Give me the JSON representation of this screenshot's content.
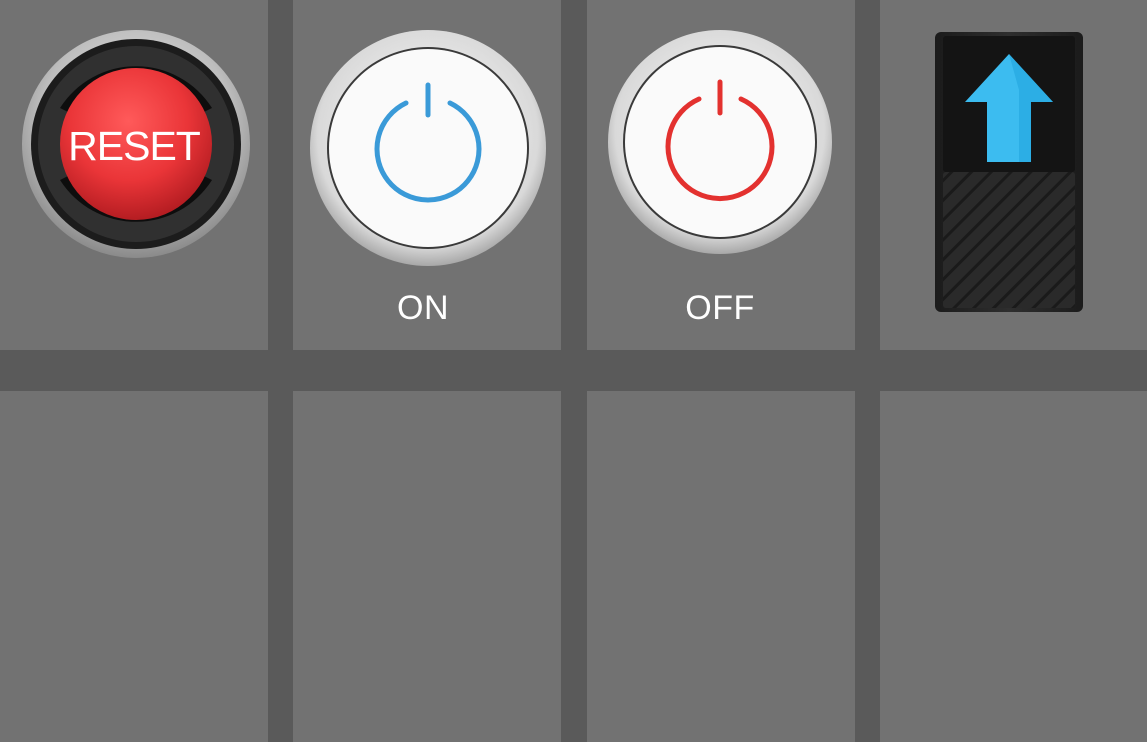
{
  "panel": {
    "buttons": [
      {
        "label": "RESET",
        "color": "#e8363a"
      },
      {
        "label": "",
        "caption": "ON",
        "icon": "power-icon",
        "icon_color": "#3a9ad8"
      },
      {
        "label": "",
        "caption": "OFF",
        "icon": "power-icon",
        "icon_color": "#e3312f"
      }
    ],
    "rocker": {
      "icon": "arrow-up-icon",
      "arrow_color": "#3cbcf0"
    }
  },
  "colors": {
    "background": "#5a5a5a",
    "tile": "#727272"
  }
}
